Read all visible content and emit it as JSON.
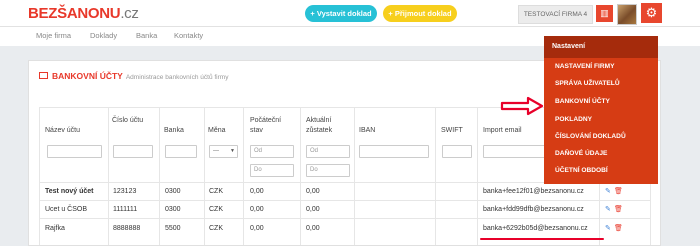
{
  "logo": {
    "part1": "BEZ",
    "part2": "ŠANONU",
    "part3": ".cz"
  },
  "header": {
    "create_label": "+ Vystavit doklad",
    "receive_label": "+ Přijmout doklad",
    "company_label": "TESTOVACÍ FIRMA 4"
  },
  "nav": [
    "Moje firma",
    "Doklady",
    "Banka",
    "Kontakty"
  ],
  "panel": {
    "title": "BANKOVNÍ ÚČTY",
    "subtitle": "Administrace bankovních účtů firmy"
  },
  "table": {
    "headers": [
      "Název účtu",
      "Číslo účtu",
      "Banka",
      "Měna",
      "Počáteční stav",
      "Aktuální zůstatek",
      "IBAN",
      "SWIFT",
      "Import email"
    ],
    "filters": {
      "currency": "---",
      "from": "Od",
      "to": "Do"
    },
    "rows": [
      {
        "name": "Test nový účet",
        "number": "123123",
        "bank": "0300",
        "currency": "CZK",
        "initial": "0,00",
        "current": "0,00",
        "iban": "",
        "swift": "",
        "email": "banka+fee12f01@bezsanonu.cz"
      },
      {
        "name": "Ucet u ČSOB",
        "number": "1111111",
        "bank": "0300",
        "currency": "CZK",
        "initial": "0,00",
        "current": "0,00",
        "iban": "",
        "swift": "",
        "email": "banka+fdd99dfb@bezsanonu.cz"
      },
      {
        "name": "Rajfka",
        "number": "8888888",
        "bank": "5500",
        "currency": "CZK",
        "initial": "0,00",
        "current": "0,00",
        "iban": "",
        "swift": "",
        "email": "banka+6292b05d@bezsanonu.cz"
      }
    ]
  },
  "settings_menu": {
    "title": "Nastavení",
    "items": [
      "NASTAVENÍ FIRMY",
      "SPRÁVA UŽIVATELŮ",
      "BANKOVNÍ ÚČTY",
      "POKLADNY",
      "ČÍSLOVÁNÍ DOKLADŮ",
      "DAŇOVÉ ÚDAJE",
      "ÚČETNÍ OBDOBÍ"
    ]
  },
  "colors": {
    "accent": "#e8382a",
    "teal": "#27c1d6",
    "yellow": "#f7cf1d",
    "menu": "#d63c14",
    "menu_header": "#a52b0c"
  },
  "icons": {
    "create": "plus-icon",
    "receive": "plus-icon",
    "company": "building-icon",
    "settings": "gear-icon",
    "edit": "pencil-icon",
    "delete": "trash-icon"
  }
}
